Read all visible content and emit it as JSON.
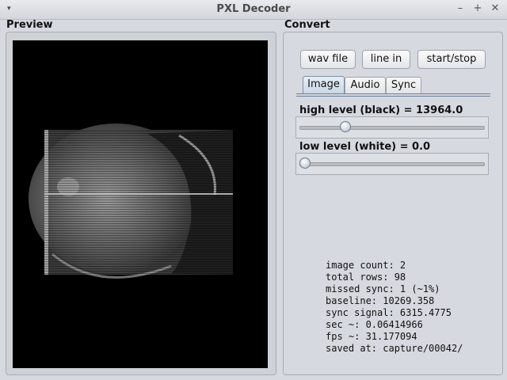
{
  "window": {
    "title": "PXL Decoder",
    "menu_icon": "▾",
    "minimize": "–",
    "maximize": "+",
    "close": "✕"
  },
  "preview": {
    "label": "Preview"
  },
  "convert": {
    "label": "Convert",
    "buttons": [
      "wav file",
      "line in",
      "start/stop"
    ],
    "tabs": [
      {
        "label": "Image",
        "active": true
      },
      {
        "label": "Audio",
        "active": false
      },
      {
        "label": "Sync",
        "active": false
      }
    ],
    "high_level_label": "high level (black) = 13964.0",
    "high_level_fraction": 0.23,
    "low_level_label": "low level (white) = 0.0",
    "low_level_fraction": 0.0
  },
  "stats": [
    "image count: 2",
    "total rows: 98",
    "missed sync: 1 (~1%)",
    "baseline: 10269.358",
    "sync signal: 6315.4775",
    "sec ~: 0.06414966",
    "fps ~: 31.177094",
    "saved at: capture/00042/"
  ],
  "colors": {
    "window_bg": "#d6d9df",
    "preview_bg": "#000000",
    "active_tab": "#c8d6e6"
  }
}
